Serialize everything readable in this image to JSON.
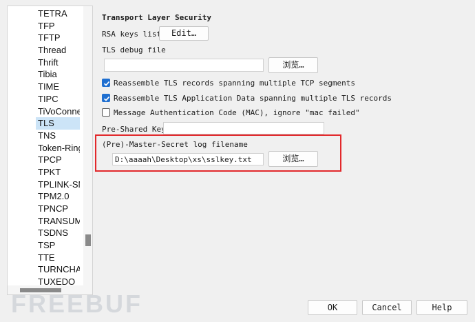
{
  "protocol_list": {
    "items": [
      "TETRA",
      "TFP",
      "TFTP",
      "Thread",
      "Thrift",
      "Tibia",
      "TIME",
      "TIPC",
      "TiVoConne",
      "TLS",
      "TNS",
      "Token-Ring",
      "TPCP",
      "TPKT",
      "TPLINK-SM",
      "TPM2.0",
      "TPNCP",
      "TRANSUM",
      "TSDNS",
      "TSP",
      "TTE",
      "TURNCHAN",
      "TUXEDO"
    ],
    "selected": "TLS"
  },
  "section_title": "Transport Layer Security",
  "rsa_keys": {
    "label": "RSA keys list",
    "button": "Edit…"
  },
  "tls_debug": {
    "label": "TLS debug file",
    "value": "",
    "button": "浏览…"
  },
  "checkboxes": [
    {
      "label": "Reassemble TLS records spanning multiple TCP segments",
      "checked": true
    },
    {
      "label": "Reassemble TLS Application Data spanning multiple TLS records",
      "checked": true
    },
    {
      "label": "Message Authentication Code (MAC), ignore \"mac failed\"",
      "checked": false
    }
  ],
  "pre_shared_key": {
    "label": "Pre-Shared Key",
    "value": ""
  },
  "master_secret": {
    "label": "(Pre)-Master-Secret log filename",
    "value": "D:\\aaaah\\Desktop\\xs\\sslkey.txt",
    "button": "浏览…"
  },
  "dialog_buttons": {
    "ok": "OK",
    "cancel": "Cancel",
    "help": "Help"
  },
  "watermark": "FREEBUF",
  "colors": {
    "highlight": "#e2282b",
    "checkbox": "#1f6fd0",
    "selection": "#cce4f7"
  }
}
